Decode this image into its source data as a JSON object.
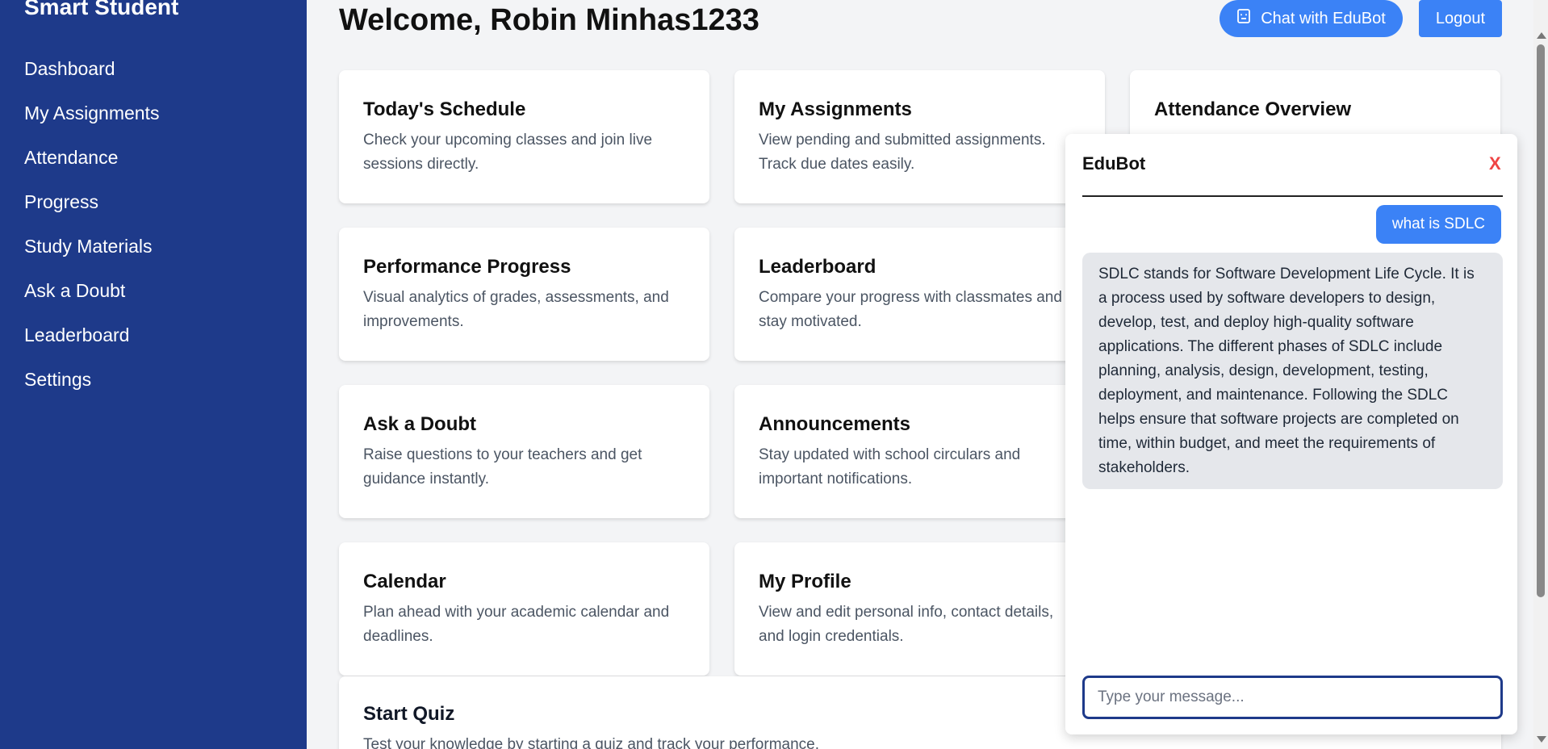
{
  "sidebar": {
    "brand": "Smart Student",
    "items": [
      {
        "label": "Dashboard"
      },
      {
        "label": "My Assignments"
      },
      {
        "label": "Attendance"
      },
      {
        "label": "Progress"
      },
      {
        "label": "Study Materials"
      },
      {
        "label": "Ask a Doubt"
      },
      {
        "label": "Leaderboard"
      },
      {
        "label": "Settings"
      }
    ]
  },
  "header": {
    "welcome": "Welcome, Robin Minhas1233",
    "chat_button": "Chat with EduBot",
    "logout_button": "Logout"
  },
  "cards": [
    {
      "title": "Today's Schedule",
      "desc": "Check your upcoming classes and join live sessions directly."
    },
    {
      "title": "My Assignments",
      "desc": "View pending and submitted assignments. Track due dates easily."
    },
    {
      "title": "Attendance Overview",
      "desc": ""
    },
    {
      "title": "Performance Progress",
      "desc": "Visual analytics of grades, assessments, and improvements."
    },
    {
      "title": "Leaderboard",
      "desc": "Compare your progress with classmates and stay motivated."
    },
    {
      "title": "Ask a Doubt",
      "desc": "Raise questions to your teachers and get guidance instantly."
    },
    {
      "title": "Announcements",
      "desc": "Stay updated with school circulars and important notifications."
    },
    {
      "title": "Calendar",
      "desc": "Plan ahead with your academic calendar and deadlines."
    },
    {
      "title": "My Profile",
      "desc": "View and edit personal info, contact details, and login credentials."
    }
  ],
  "quiz": {
    "title": "Start Quiz",
    "desc": "Test your knowledge by starting a quiz and track your performance."
  },
  "chat": {
    "title": "EduBot",
    "close": "X",
    "user_message": "what is SDLC",
    "bot_message": "SDLC stands for Software Development Life Cycle. It is a process used by software developers to design, develop, test, and deploy high-quality software applications. The different phases of SDLC include planning, analysis, design, development, testing, deployment, and maintenance. Following the SDLC helps ensure that software projects are completed on time, within budget, and meet the requirements of stakeholders.",
    "input_placeholder": "Type your message..."
  },
  "colors": {
    "sidebar_bg": "#1e3a8a",
    "accent": "#3b82f6",
    "close_red": "#ef4444",
    "page_bg": "#f3f4f6"
  },
  "icons": {
    "chat_button_icon": "robot-icon"
  }
}
